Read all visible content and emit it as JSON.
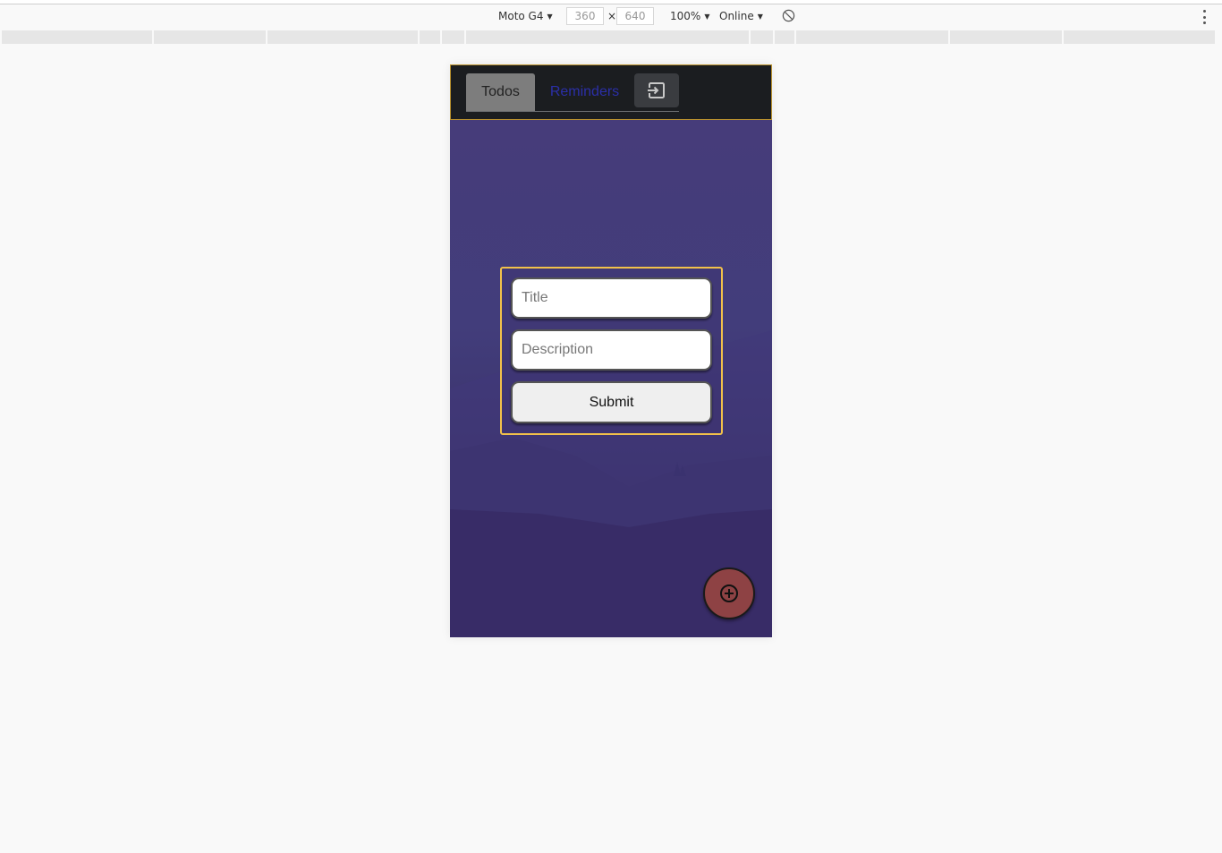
{
  "devtools": {
    "device": "Moto G4",
    "width": "360",
    "height": "640",
    "times": "×",
    "zoom": "100%",
    "network": "Online"
  },
  "app": {
    "tabs": {
      "todos": "Todos",
      "reminders": "Reminders"
    },
    "form": {
      "title_placeholder": "Title",
      "description_placeholder": "Description",
      "submit_label": "Submit"
    },
    "colors": {
      "header_bg": "#1b1d20",
      "active_tab": "#7d7d7d",
      "reminders_link": "#2b2fa8",
      "form_border": "#f2c14a",
      "fab_bg": "#8e4244"
    }
  }
}
